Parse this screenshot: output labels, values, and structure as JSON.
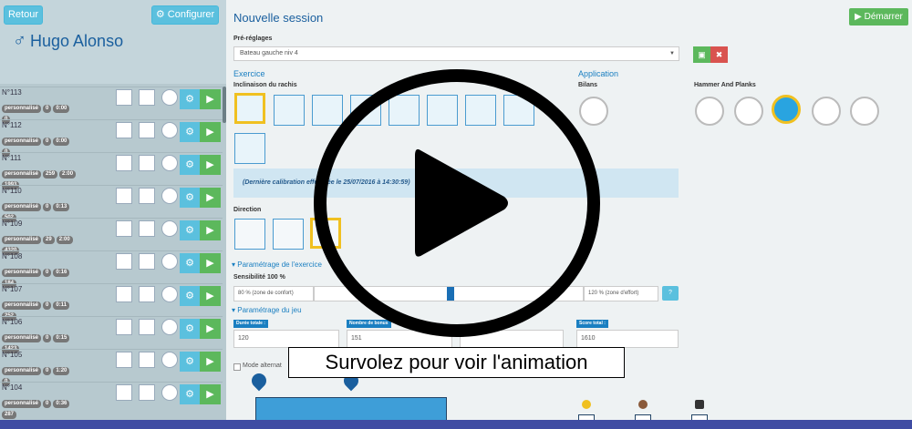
{
  "sidebar": {
    "back_label": "Retour",
    "config_label": "Configurer",
    "user_symbol": "♂",
    "user_name": "Hugo Alonso",
    "sessions": [
      {
        "num": "N°113",
        "type": "personnalisé",
        "score": "0",
        "time": "0:00",
        "points": "0"
      },
      {
        "num": "N°112",
        "type": "personnalisé",
        "score": "0",
        "time": "0:00",
        "points": "0"
      },
      {
        "num": "N°111",
        "type": "personnalisé",
        "score": "259",
        "time": "2:00",
        "points": "1993"
      },
      {
        "num": "N°110",
        "type": "personnalisé",
        "score": "0",
        "time": "0:13",
        "points": "502"
      },
      {
        "num": "N°109",
        "type": "personnalisé",
        "score": "29",
        "time": "2:00",
        "points": "4320"
      },
      {
        "num": "N°108",
        "type": "personnalisé",
        "score": "0",
        "time": "0:16",
        "points": "184"
      },
      {
        "num": "N°107",
        "type": "personnalisé",
        "score": "0",
        "time": "0:11",
        "points": "252"
      },
      {
        "num": "N°106",
        "type": "personnalisé",
        "score": "0",
        "time": "0:15",
        "points": "1423"
      },
      {
        "num": "N°105",
        "type": "personnalisé",
        "score": "0",
        "time": "1:20",
        "points": "0"
      },
      {
        "num": "N°104",
        "type": "personnalisé",
        "score": "0",
        "time": "0:36",
        "points": "287"
      }
    ]
  },
  "main": {
    "title": "Nouvelle session",
    "start_label": "Démarrer",
    "presets_label": "Pré-réglages",
    "preset_value": "Bateau gauche niv 4",
    "exercise_title": "Exercice",
    "inclination_label": "Inclinaison du rachis",
    "application_title": "Application",
    "bilans_label": "Bilans",
    "hammer_label": "Hammer And Planks",
    "calibration_text": "(Dernière calibration effectuée le 25/07/2016 à 14:30:59)",
    "direction_label": "Direction",
    "exercise_params_title": "Paramétrage de l'exercice",
    "sensitivity_label": "Sensibilité 100 %",
    "comfort_label": "80 % (zone de confort)",
    "effort_label": "120 % (zone d'effort)",
    "game_params_title": "Paramétrage du jeu",
    "total_duration_label": "Durée totale :",
    "total_duration_value": "120",
    "bonus_label": "Nombre de bonus",
    "bonus_value": "151",
    "score_label": "Score total :",
    "score_value": "1610",
    "mode_label": "Mode alternat"
  },
  "overlay": {
    "caption": "Survolez pour voir l'animation"
  },
  "colors": {
    "accent": "#1a7fc1",
    "info": "#5bc0de",
    "success": "#5cb85c",
    "danger": "#d9534f",
    "selected": "#f0c020"
  }
}
